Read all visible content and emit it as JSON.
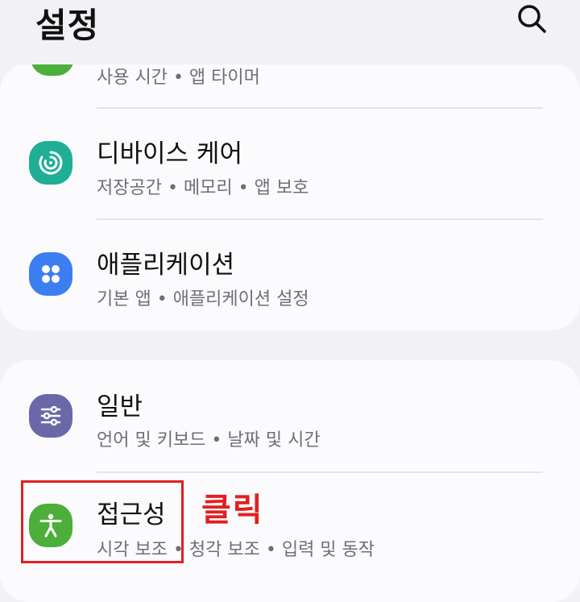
{
  "header": {
    "title": "설정"
  },
  "rows": {
    "partial": {
      "sub": "사용 시간 • 앱 타이머"
    },
    "device_care": {
      "label": "디바이스 케어",
      "sub": "저장공간 • 메모리 • 앱 보호"
    },
    "apps": {
      "label": "애플리케이션",
      "sub": "기본 앱 • 애플리케이션 설정"
    },
    "general": {
      "label": "일반",
      "sub": "언어 및 키보드 • 날짜 및 시간"
    },
    "accessibility": {
      "label": "접근성",
      "sub": "시각 보조 • 청각 보조 • 입력 및 동작"
    }
  },
  "annotation": {
    "text": "클릭",
    "color": "#e02020"
  },
  "icons": {
    "search": "search-icon",
    "device_care": "device-care-icon",
    "apps": "apps-grid-icon",
    "general": "sliders-icon",
    "accessibility": "accessibility-icon"
  },
  "colors": {
    "background": "#f1f1f6",
    "card": "#fbfbfe",
    "device_care": "#1fae96",
    "apps": "#3d7df2",
    "general": "#6a68a8",
    "accessibility": "#4caf3a"
  }
}
